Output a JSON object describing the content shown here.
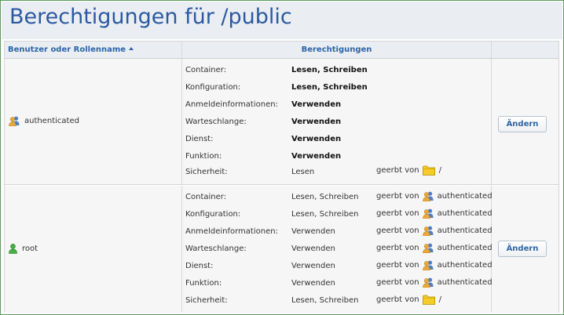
{
  "page": {
    "title": "Berechtigungen für /public"
  },
  "table": {
    "headers": {
      "user": "Benutzer oder Rollenname",
      "permissions": "Berechtigungen",
      "actions": ""
    },
    "rows": [
      {
        "name": "authenticated",
        "icon": "role-icon",
        "change_label": "Ändern",
        "permissions": [
          {
            "type": "Container:",
            "value": "Lesen, Schreiben",
            "bold": true,
            "inherited_text": "",
            "inherited_from": "",
            "inherited_icon": ""
          },
          {
            "type": "Konfiguration:",
            "value": "Lesen, Schreiben",
            "bold": true,
            "inherited_text": "",
            "inherited_from": "",
            "inherited_icon": ""
          },
          {
            "type": "Anmeldeinformationen:",
            "value": "Verwenden",
            "bold": true,
            "inherited_text": "",
            "inherited_from": "",
            "inherited_icon": ""
          },
          {
            "type": "Warteschlange:",
            "value": "Verwenden",
            "bold": true,
            "inherited_text": "",
            "inherited_from": "",
            "inherited_icon": ""
          },
          {
            "type": "Dienst:",
            "value": "Verwenden",
            "bold": true,
            "inherited_text": "",
            "inherited_from": "",
            "inherited_icon": ""
          },
          {
            "type": "Funktion:",
            "value": "Verwenden",
            "bold": true,
            "inherited_text": "",
            "inherited_from": "",
            "inherited_icon": ""
          },
          {
            "type": "Sicherheit:",
            "value": "Lesen",
            "bold": false,
            "inherited_text": "geerbt von",
            "inherited_from": "/",
            "inherited_icon": "folder-icon"
          }
        ]
      },
      {
        "name": "root",
        "icon": "user-icon",
        "change_label": "Ändern",
        "permissions": [
          {
            "type": "Container:",
            "value": "Lesen, Schreiben",
            "bold": false,
            "inherited_text": "geerbt von",
            "inherited_from": "authenticated",
            "inherited_icon": "role-icon"
          },
          {
            "type": "Konfiguration:",
            "value": "Lesen, Schreiben",
            "bold": false,
            "inherited_text": "geerbt von",
            "inherited_from": "authenticated",
            "inherited_icon": "role-icon"
          },
          {
            "type": "Anmeldeinformationen:",
            "value": "Verwenden",
            "bold": false,
            "inherited_text": "geerbt von",
            "inherited_from": "authenticated",
            "inherited_icon": "role-icon"
          },
          {
            "type": "Warteschlange:",
            "value": "Verwenden",
            "bold": false,
            "inherited_text": "geerbt von",
            "inherited_from": "authenticated",
            "inherited_icon": "role-icon"
          },
          {
            "type": "Dienst:",
            "value": "Verwenden",
            "bold": false,
            "inherited_text": "geerbt von",
            "inherited_from": "authenticated",
            "inherited_icon": "role-icon"
          },
          {
            "type": "Funktion:",
            "value": "Verwenden",
            "bold": false,
            "inherited_text": "geerbt von",
            "inherited_from": "authenticated",
            "inherited_icon": "role-icon"
          },
          {
            "type": "Sicherheit:",
            "value": "Lesen, Schreiben",
            "bold": false,
            "inherited_text": "geerbt von",
            "inherited_from": "/",
            "inherited_icon": "folder-icon"
          }
        ]
      }
    ]
  },
  "colors": {
    "title": "#2b59a0",
    "header_link": "#2b64a8",
    "header_bg": "#eaeef3",
    "row_bg": "#f6f6f6",
    "folder": "#f2c200",
    "user_green": "#3aa335"
  }
}
